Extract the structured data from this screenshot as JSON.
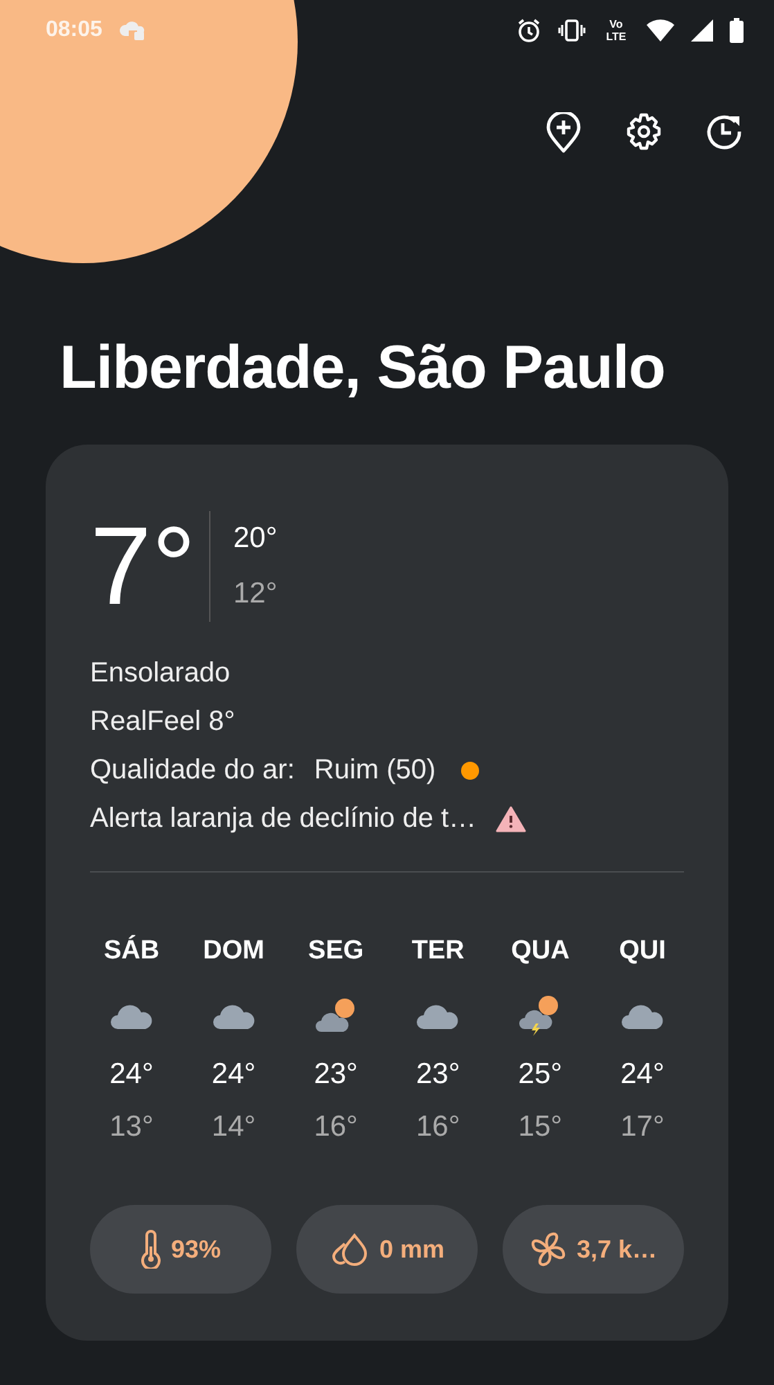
{
  "status_bar": {
    "time": "08:05",
    "network_label": "Vo LTE"
  },
  "location": {
    "title": "Liberdade, São Paulo"
  },
  "current": {
    "temperature": "7°",
    "high": "20°",
    "low": "12°",
    "condition": "Ensolarado",
    "realfeel": "RealFeel 8°",
    "air_quality": {
      "label": "Qualidade do ar:",
      "value": "Ruim (50)",
      "color": "#ff9800"
    },
    "alert": "Alerta laranja de declínio de t…"
  },
  "forecast": [
    {
      "day": "SÁB",
      "kind": "cloudy",
      "high": "24°",
      "low": "13°"
    },
    {
      "day": "DOM",
      "kind": "cloudy",
      "high": "24°",
      "low": "14°"
    },
    {
      "day": "SEG",
      "kind": "partly_cloudy",
      "high": "23°",
      "low": "16°"
    },
    {
      "day": "TER",
      "kind": "cloudy",
      "high": "23°",
      "low": "16°"
    },
    {
      "day": "QUA",
      "kind": "thunder",
      "high": "25°",
      "low": "15°"
    },
    {
      "day": "QUI",
      "kind": "cloudy",
      "high": "24°",
      "low": "17°"
    }
  ],
  "chips": [
    {
      "kind": "humidity",
      "text": "93%"
    },
    {
      "kind": "rain",
      "text": "0 mm"
    },
    {
      "kind": "wind",
      "text": "3,7 k…"
    }
  ]
}
